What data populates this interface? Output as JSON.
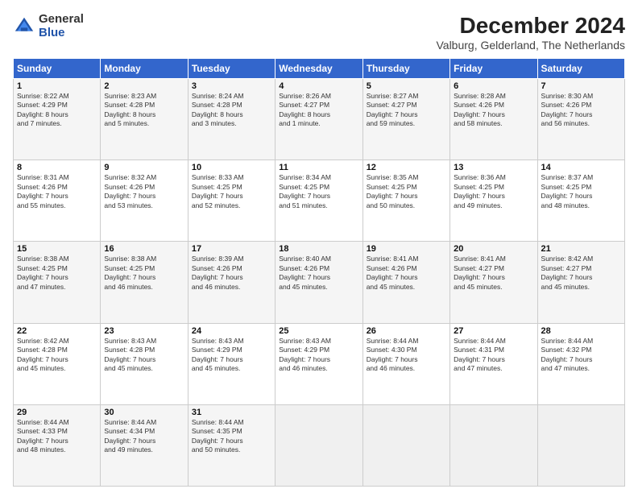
{
  "logo": {
    "general": "General",
    "blue": "Blue"
  },
  "title": "December 2024",
  "subtitle": "Valburg, Gelderland, The Netherlands",
  "days_of_week": [
    "Sunday",
    "Monday",
    "Tuesday",
    "Wednesday",
    "Thursday",
    "Friday",
    "Saturday"
  ],
  "weeks": [
    [
      {
        "day": "1",
        "info": "Sunrise: 8:22 AM\nSunset: 4:29 PM\nDaylight: 8 hours\nand 7 minutes."
      },
      {
        "day": "2",
        "info": "Sunrise: 8:23 AM\nSunset: 4:28 PM\nDaylight: 8 hours\nand 5 minutes."
      },
      {
        "day": "3",
        "info": "Sunrise: 8:24 AM\nSunset: 4:28 PM\nDaylight: 8 hours\nand 3 minutes."
      },
      {
        "day": "4",
        "info": "Sunrise: 8:26 AM\nSunset: 4:27 PM\nDaylight: 8 hours\nand 1 minute."
      },
      {
        "day": "5",
        "info": "Sunrise: 8:27 AM\nSunset: 4:27 PM\nDaylight: 7 hours\nand 59 minutes."
      },
      {
        "day": "6",
        "info": "Sunrise: 8:28 AM\nSunset: 4:26 PM\nDaylight: 7 hours\nand 58 minutes."
      },
      {
        "day": "7",
        "info": "Sunrise: 8:30 AM\nSunset: 4:26 PM\nDaylight: 7 hours\nand 56 minutes."
      }
    ],
    [
      {
        "day": "8",
        "info": "Sunrise: 8:31 AM\nSunset: 4:26 PM\nDaylight: 7 hours\nand 55 minutes."
      },
      {
        "day": "9",
        "info": "Sunrise: 8:32 AM\nSunset: 4:26 PM\nDaylight: 7 hours\nand 53 minutes."
      },
      {
        "day": "10",
        "info": "Sunrise: 8:33 AM\nSunset: 4:25 PM\nDaylight: 7 hours\nand 52 minutes."
      },
      {
        "day": "11",
        "info": "Sunrise: 8:34 AM\nSunset: 4:25 PM\nDaylight: 7 hours\nand 51 minutes."
      },
      {
        "day": "12",
        "info": "Sunrise: 8:35 AM\nSunset: 4:25 PM\nDaylight: 7 hours\nand 50 minutes."
      },
      {
        "day": "13",
        "info": "Sunrise: 8:36 AM\nSunset: 4:25 PM\nDaylight: 7 hours\nand 49 minutes."
      },
      {
        "day": "14",
        "info": "Sunrise: 8:37 AM\nSunset: 4:25 PM\nDaylight: 7 hours\nand 48 minutes."
      }
    ],
    [
      {
        "day": "15",
        "info": "Sunrise: 8:38 AM\nSunset: 4:25 PM\nDaylight: 7 hours\nand 47 minutes."
      },
      {
        "day": "16",
        "info": "Sunrise: 8:38 AM\nSunset: 4:25 PM\nDaylight: 7 hours\nand 46 minutes."
      },
      {
        "day": "17",
        "info": "Sunrise: 8:39 AM\nSunset: 4:26 PM\nDaylight: 7 hours\nand 46 minutes."
      },
      {
        "day": "18",
        "info": "Sunrise: 8:40 AM\nSunset: 4:26 PM\nDaylight: 7 hours\nand 45 minutes."
      },
      {
        "day": "19",
        "info": "Sunrise: 8:41 AM\nSunset: 4:26 PM\nDaylight: 7 hours\nand 45 minutes."
      },
      {
        "day": "20",
        "info": "Sunrise: 8:41 AM\nSunset: 4:27 PM\nDaylight: 7 hours\nand 45 minutes."
      },
      {
        "day": "21",
        "info": "Sunrise: 8:42 AM\nSunset: 4:27 PM\nDaylight: 7 hours\nand 45 minutes."
      }
    ],
    [
      {
        "day": "22",
        "info": "Sunrise: 8:42 AM\nSunset: 4:28 PM\nDaylight: 7 hours\nand 45 minutes."
      },
      {
        "day": "23",
        "info": "Sunrise: 8:43 AM\nSunset: 4:28 PM\nDaylight: 7 hours\nand 45 minutes."
      },
      {
        "day": "24",
        "info": "Sunrise: 8:43 AM\nSunset: 4:29 PM\nDaylight: 7 hours\nand 45 minutes."
      },
      {
        "day": "25",
        "info": "Sunrise: 8:43 AM\nSunset: 4:29 PM\nDaylight: 7 hours\nand 46 minutes."
      },
      {
        "day": "26",
        "info": "Sunrise: 8:44 AM\nSunset: 4:30 PM\nDaylight: 7 hours\nand 46 minutes."
      },
      {
        "day": "27",
        "info": "Sunrise: 8:44 AM\nSunset: 4:31 PM\nDaylight: 7 hours\nand 47 minutes."
      },
      {
        "day": "28",
        "info": "Sunrise: 8:44 AM\nSunset: 4:32 PM\nDaylight: 7 hours\nand 47 minutes."
      }
    ],
    [
      {
        "day": "29",
        "info": "Sunrise: 8:44 AM\nSunset: 4:33 PM\nDaylight: 7 hours\nand 48 minutes."
      },
      {
        "day": "30",
        "info": "Sunrise: 8:44 AM\nSunset: 4:34 PM\nDaylight: 7 hours\nand 49 minutes."
      },
      {
        "day": "31",
        "info": "Sunrise: 8:44 AM\nSunset: 4:35 PM\nDaylight: 7 hours\nand 50 minutes."
      },
      {
        "day": "",
        "info": ""
      },
      {
        "day": "",
        "info": ""
      },
      {
        "day": "",
        "info": ""
      },
      {
        "day": "",
        "info": ""
      }
    ]
  ]
}
